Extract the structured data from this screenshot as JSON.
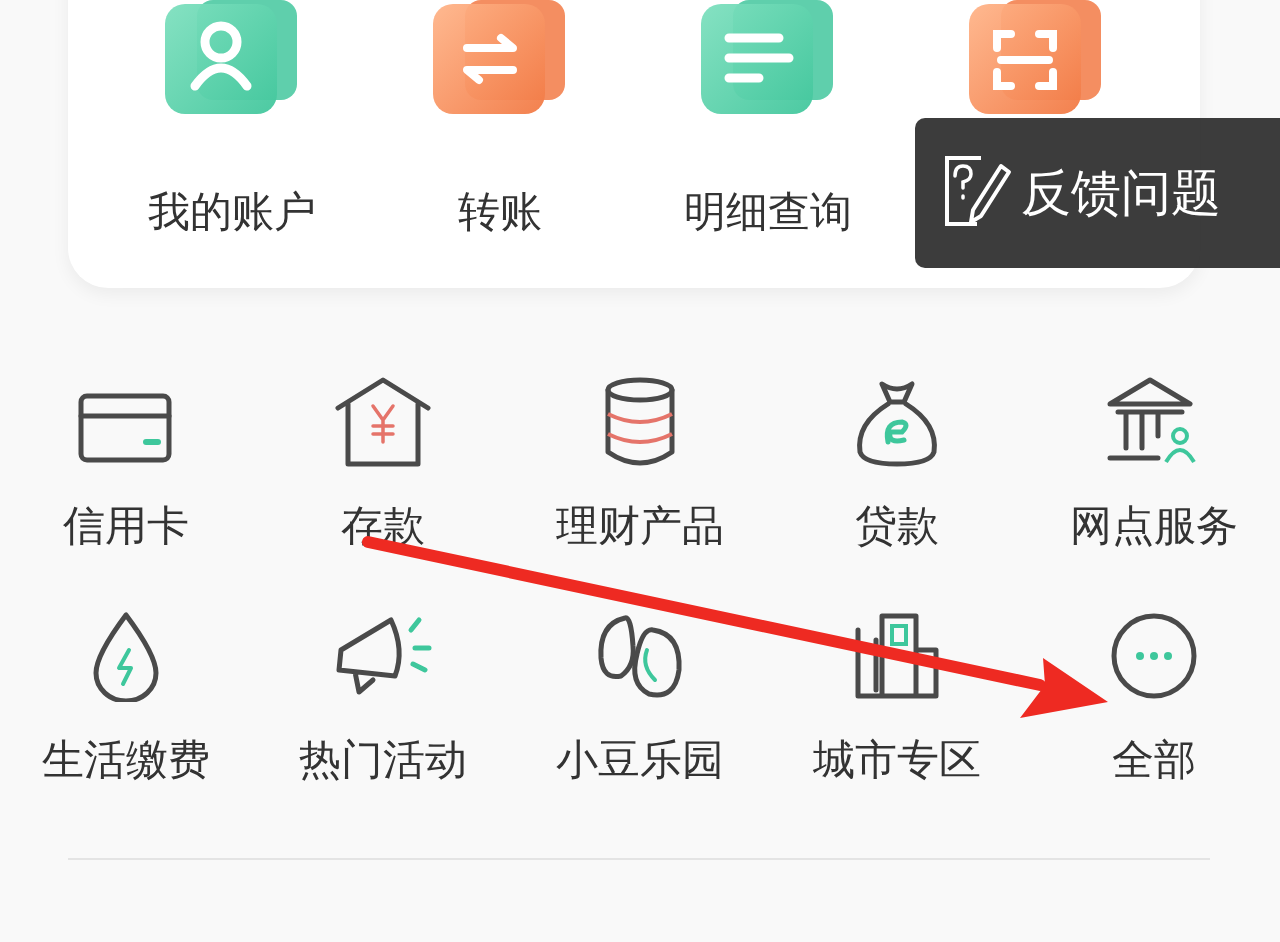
{
  "quick_actions": [
    {
      "kind": "person",
      "label": "我的账户"
    },
    {
      "kind": "transfer",
      "label": "转账"
    },
    {
      "kind": "list",
      "label": "明细查询"
    },
    {
      "kind": "scan"
    }
  ],
  "feedback_popup": {
    "label": "反馈问题"
  },
  "services": [
    {
      "kind": "card",
      "label": "信用卡"
    },
    {
      "kind": "deposit",
      "label": "存款"
    },
    {
      "kind": "coins",
      "label": "理财产品"
    },
    {
      "kind": "loan",
      "label": "贷款"
    },
    {
      "kind": "bank",
      "label": "网点服务"
    },
    {
      "kind": "water",
      "label": "生活缴费"
    },
    {
      "kind": "megaphone",
      "label": "热门活动"
    },
    {
      "kind": "beans",
      "label": "小豆乐园"
    },
    {
      "kind": "city",
      "label": "城市专区"
    },
    {
      "kind": "more",
      "label": "全部"
    }
  ],
  "annotation": {
    "kind": "arrow"
  }
}
